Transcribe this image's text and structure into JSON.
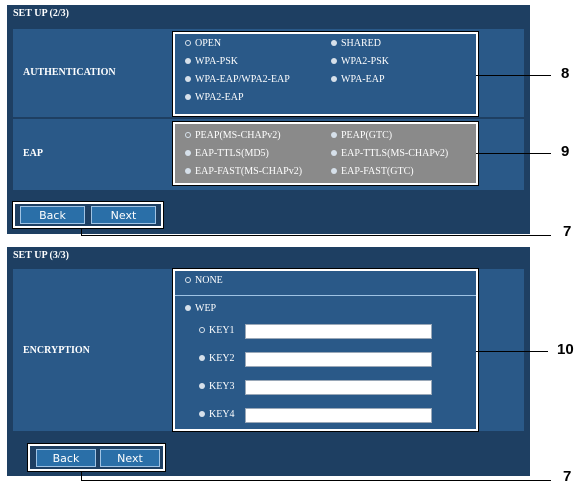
{
  "setup2": {
    "title": "SET UP (2/3)",
    "authentication": {
      "label": "AUTHENTICATION",
      "options": [
        "OPEN",
        "SHARED",
        "WPA-PSK",
        "WPA2-PSK",
        "WPA-EAP/WPA2-EAP",
        "WPA-EAP",
        "WPA2-EAP"
      ],
      "selected": "OPEN"
    },
    "eap": {
      "label": "EAP",
      "options": [
        "PEAP(MS-CHAPv2)",
        "PEAP(GTC)",
        "EAP-TTLS(MD5)",
        "EAP-TTLS(MS-CHAPv2)",
        "EAP-FAST(MS-CHAPv2)",
        "EAP-FAST(GTC)"
      ],
      "selected": "PEAP(MS-CHAPv2)"
    },
    "back_label": "Back",
    "next_label": "Next"
  },
  "setup3": {
    "title": "SET UP (3/3)",
    "encryption": {
      "label": "ENCRYPTION",
      "none_label": "NONE",
      "wep_label": "WEP",
      "keys": [
        {
          "label": "KEY1",
          "value": ""
        },
        {
          "label": "KEY2",
          "value": ""
        },
        {
          "label": "KEY3",
          "value": ""
        },
        {
          "label": "KEY4",
          "value": ""
        }
      ],
      "selected": "NONE",
      "selected_key": "KEY1"
    },
    "back_label": "Back",
    "next_label": "Next"
  },
  "callouts": {
    "auth": "8",
    "eap": "9",
    "buttons_top": "7",
    "encryption": "10",
    "buttons_bottom": "7"
  },
  "colors": {
    "panel": "#1e3f62",
    "row": "#2a5988",
    "eap_box": "#8a8a8a",
    "button": "#2a6fa8"
  }
}
